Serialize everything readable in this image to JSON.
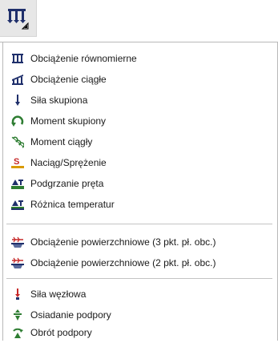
{
  "toolbar": {
    "button_icon": "uniform-load-dropdown-icon"
  },
  "menu": {
    "group1": [
      {
        "label": "Obciążenie równomierne",
        "icon": "uniform-load-icon"
      },
      {
        "label": "Obciążenie ciągłe",
        "icon": "continuous-load-icon"
      },
      {
        "label": "Siła skupiona",
        "icon": "point-force-icon"
      },
      {
        "label": "Moment skupiony",
        "icon": "point-moment-icon"
      },
      {
        "label": "Moment ciągły",
        "icon": "distributed-moment-icon"
      },
      {
        "label": "Naciąg/Sprężenie",
        "icon": "prestress-icon"
      },
      {
        "label": "Podgrzanie pręta",
        "icon": "bar-heating-icon"
      },
      {
        "label": "Różnica temperatur",
        "icon": "temperature-difference-icon"
      }
    ],
    "group2": [
      {
        "label": "Obciążenie powierzchniowe (3 pkt. pł. obc.)",
        "icon": "surface-load-3pt-icon"
      },
      {
        "label": "Obciążenie powierzchniowe (2 pkt. pł. obc.)",
        "icon": "surface-load-2pt-icon"
      }
    ],
    "group3": [
      {
        "label": "Siła węzłowa",
        "icon": "nodal-force-icon"
      },
      {
        "label": "Osiadanie podpory",
        "icon": "support-settlement-icon"
      },
      {
        "label": "Obrót podpory",
        "icon": "support-rotation-icon"
      }
    ]
  },
  "colors": {
    "icon_navy": "#1f2f6b",
    "icon_green": "#2e7d32",
    "icon_red": "#c62828",
    "icon_orange": "#d99a00"
  }
}
